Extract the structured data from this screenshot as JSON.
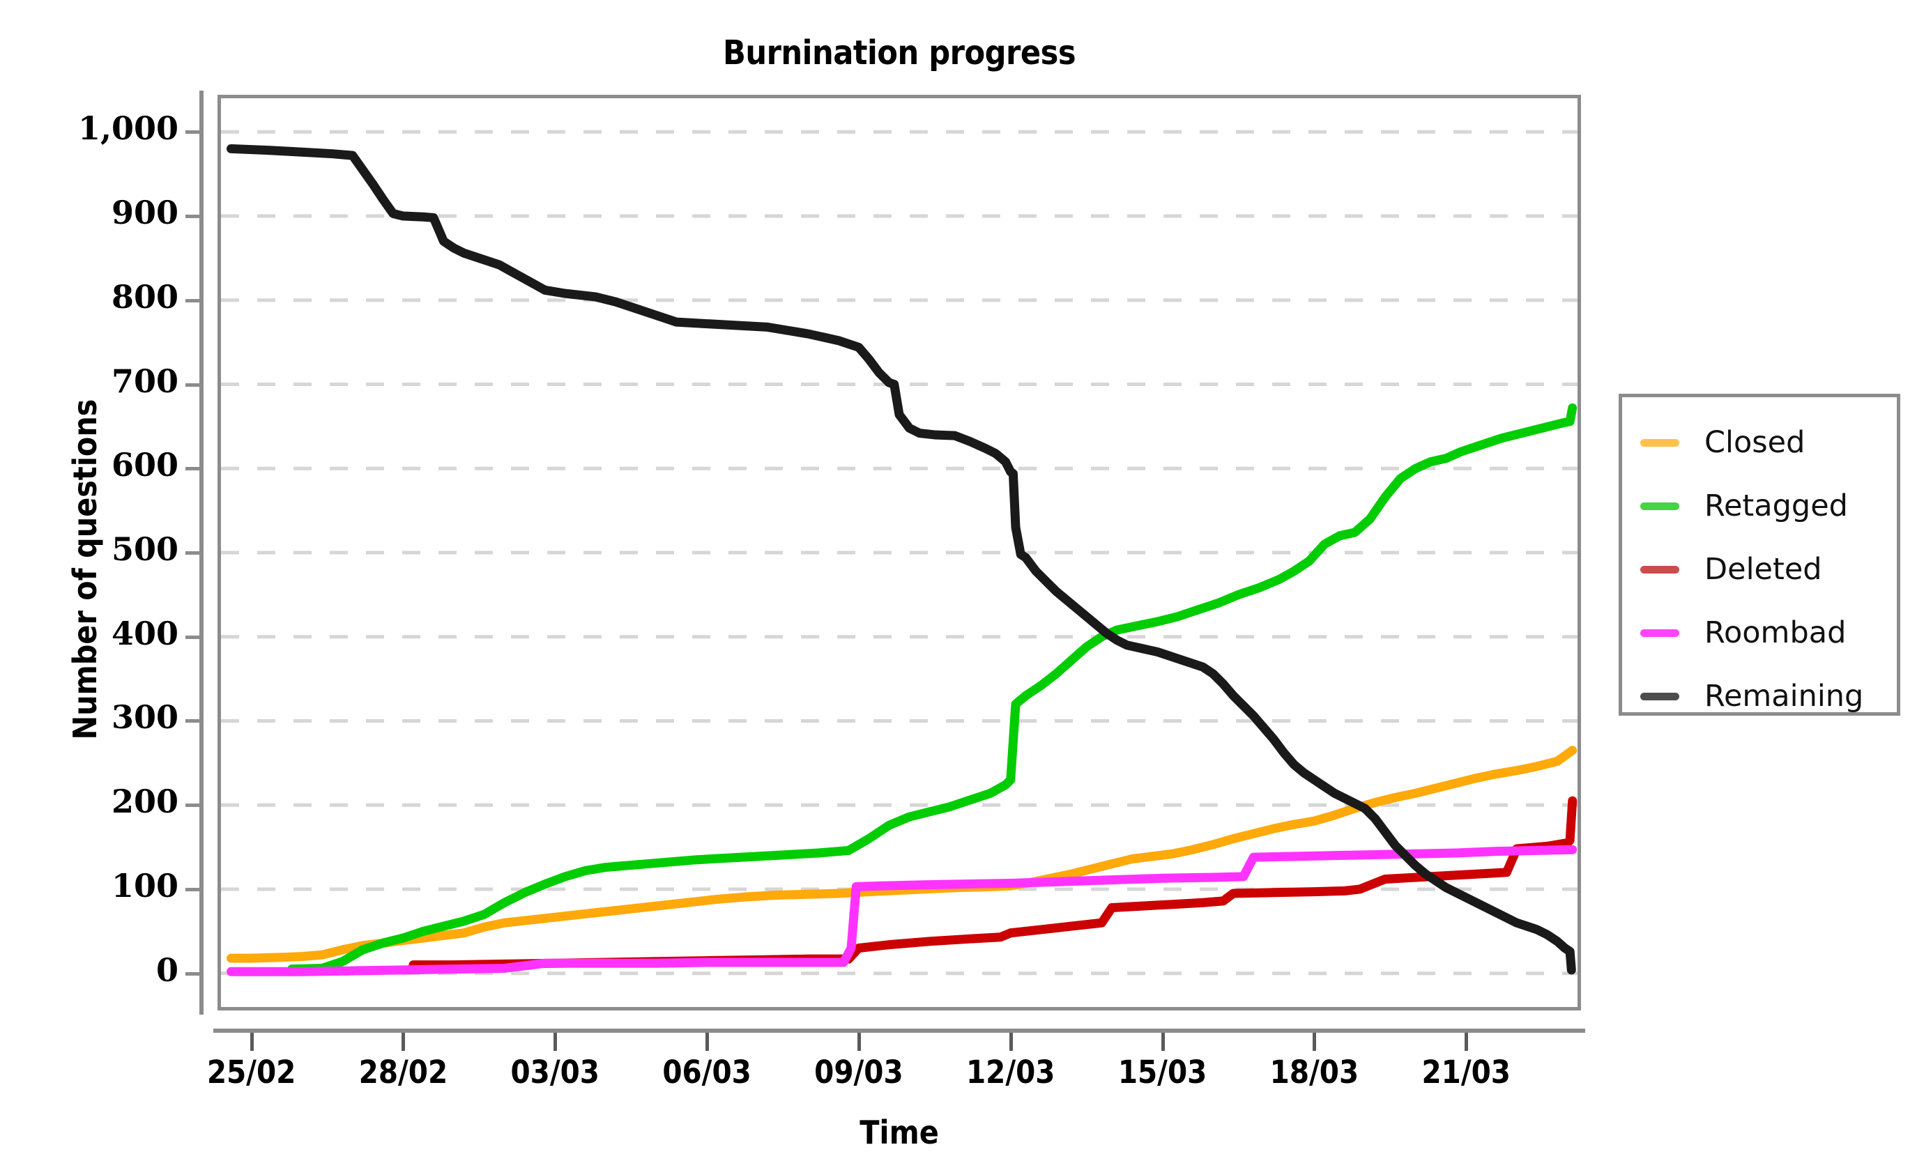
{
  "chart_data": {
    "type": "line",
    "title": "Burnination progress",
    "xlabel": "Time",
    "ylabel": "Number of questions",
    "grid": "horizontal-dashed",
    "legend_position": "right-outside",
    "ylim": [
      -40,
      1040
    ],
    "yticks": [
      0,
      100,
      200,
      300,
      400,
      500,
      600,
      700,
      800,
      900,
      1000
    ],
    "ytick_labels": [
      "0",
      "100",
      "200",
      "300",
      "400",
      "500",
      "600",
      "700",
      "800",
      "900",
      "1,000"
    ],
    "xtick_labels": [
      "25/02",
      "28/02",
      "03/03",
      "06/03",
      "09/03",
      "12/03",
      "15/03",
      "18/03",
      "21/03"
    ],
    "xlim_days": [
      24.4,
      51.2
    ],
    "xtick_days": [
      25,
      28,
      31,
      34,
      37,
      40,
      43,
      46,
      49
    ],
    "series": [
      {
        "name": "Closed",
        "color": "#FFA90A",
        "legend_color": "#FFC04D",
        "points": [
          [
            24.6,
            18
          ],
          [
            25.0,
            18
          ],
          [
            25.6,
            19
          ],
          [
            26.0,
            20
          ],
          [
            26.4,
            22
          ],
          [
            26.8,
            28
          ],
          [
            27.2,
            33
          ],
          [
            27.6,
            36
          ],
          [
            28.0,
            39
          ],
          [
            28.4,
            42
          ],
          [
            28.8,
            45
          ],
          [
            29.2,
            48
          ],
          [
            29.6,
            55
          ],
          [
            30.0,
            60
          ],
          [
            30.6,
            64
          ],
          [
            31.2,
            68
          ],
          [
            31.8,
            72
          ],
          [
            32.4,
            76
          ],
          [
            33.0,
            80
          ],
          [
            33.6,
            84
          ],
          [
            34.2,
            88
          ],
          [
            34.8,
            91
          ],
          [
            35.4,
            93
          ],
          [
            36.0,
            94
          ],
          [
            36.6,
            95
          ],
          [
            37.2,
            97
          ],
          [
            37.9,
            99
          ],
          [
            38.6,
            101
          ],
          [
            39.0,
            102
          ],
          [
            39.6,
            103
          ],
          [
            40.0,
            104
          ],
          [
            40.4,
            108
          ],
          [
            40.8,
            113
          ],
          [
            41.2,
            118
          ],
          [
            41.6,
            124
          ],
          [
            42.0,
            130
          ],
          [
            42.4,
            136
          ],
          [
            42.8,
            139
          ],
          [
            43.2,
            142
          ],
          [
            43.6,
            147
          ],
          [
            44.0,
            153
          ],
          [
            44.4,
            160
          ],
          [
            44.8,
            166
          ],
          [
            45.2,
            172
          ],
          [
            45.6,
            177
          ],
          [
            46.0,
            181
          ],
          [
            46.4,
            188
          ],
          [
            46.8,
            196
          ],
          [
            47.2,
            203
          ],
          [
            47.6,
            209
          ],
          [
            48.0,
            214
          ],
          [
            48.4,
            220
          ],
          [
            48.8,
            226
          ],
          [
            49.2,
            232
          ],
          [
            49.6,
            237
          ],
          [
            50.0,
            241
          ],
          [
            50.4,
            246
          ],
          [
            50.8,
            252
          ],
          [
            51.1,
            265
          ]
        ]
      },
      {
        "name": "Retagged",
        "color": "#00CC00",
        "legend_color": "#44D444",
        "points": [
          [
            25.8,
            5
          ],
          [
            26.4,
            6
          ],
          [
            26.8,
            14
          ],
          [
            27.2,
            28
          ],
          [
            27.6,
            36
          ],
          [
            28.0,
            42
          ],
          [
            28.4,
            50
          ],
          [
            28.8,
            56
          ],
          [
            29.2,
            62
          ],
          [
            29.6,
            70
          ],
          [
            30.0,
            84
          ],
          [
            30.4,
            96
          ],
          [
            30.8,
            106
          ],
          [
            31.2,
            115
          ],
          [
            31.6,
            122
          ],
          [
            32.0,
            126
          ],
          [
            32.6,
            129
          ],
          [
            33.2,
            132
          ],
          [
            33.8,
            135
          ],
          [
            34.4,
            137
          ],
          [
            35.0,
            139
          ],
          [
            35.6,
            141
          ],
          [
            36.2,
            143
          ],
          [
            36.8,
            146
          ],
          [
            37.2,
            160
          ],
          [
            37.6,
            176
          ],
          [
            38.0,
            186
          ],
          [
            38.4,
            192
          ],
          [
            38.8,
            198
          ],
          [
            39.2,
            206
          ],
          [
            39.6,
            214
          ],
          [
            39.9,
            224
          ],
          [
            40.0,
            230
          ],
          [
            40.1,
            320
          ],
          [
            40.3,
            330
          ],
          [
            40.6,
            342
          ],
          [
            40.9,
            356
          ],
          [
            41.2,
            372
          ],
          [
            41.5,
            388
          ],
          [
            41.8,
            400
          ],
          [
            42.1,
            408
          ],
          [
            42.5,
            413
          ],
          [
            42.9,
            418
          ],
          [
            43.3,
            424
          ],
          [
            43.7,
            432
          ],
          [
            44.1,
            440
          ],
          [
            44.5,
            450
          ],
          [
            44.9,
            458
          ],
          [
            45.3,
            468
          ],
          [
            45.6,
            478
          ],
          [
            45.9,
            490
          ],
          [
            46.2,
            510
          ],
          [
            46.5,
            520
          ],
          [
            46.8,
            524
          ],
          [
            47.1,
            540
          ],
          [
            47.4,
            566
          ],
          [
            47.7,
            588
          ],
          [
            48.0,
            600
          ],
          [
            48.3,
            608
          ],
          [
            48.6,
            612
          ],
          [
            48.9,
            620
          ],
          [
            49.3,
            628
          ],
          [
            49.7,
            636
          ],
          [
            50.1,
            642
          ],
          [
            50.5,
            648
          ],
          [
            50.9,
            654
          ],
          [
            51.05,
            656
          ],
          [
            51.1,
            672
          ]
        ]
      },
      {
        "name": "Deleted",
        "color": "#CC0000",
        "legend_color": "#CC4C4C",
        "points": [
          [
            28.2,
            10
          ],
          [
            29.0,
            10
          ],
          [
            30.0,
            11
          ],
          [
            31.0,
            12
          ],
          [
            32.0,
            13
          ],
          [
            33.0,
            14
          ],
          [
            34.0,
            15
          ],
          [
            35.0,
            16
          ],
          [
            36.0,
            17
          ],
          [
            36.8,
            17
          ],
          [
            37.0,
            30
          ],
          [
            37.6,
            34
          ],
          [
            38.4,
            38
          ],
          [
            39.2,
            41
          ],
          [
            39.8,
            43
          ],
          [
            40.0,
            48
          ],
          [
            40.6,
            52
          ],
          [
            41.2,
            56
          ],
          [
            41.8,
            60
          ],
          [
            42.0,
            78
          ],
          [
            42.6,
            80
          ],
          [
            43.2,
            82
          ],
          [
            43.8,
            84
          ],
          [
            44.2,
            86
          ],
          [
            44.4,
            95
          ],
          [
            45.2,
            96
          ],
          [
            46.0,
            97
          ],
          [
            46.6,
            98
          ],
          [
            46.9,
            100
          ],
          [
            47.4,
            112
          ],
          [
            48.0,
            114
          ],
          [
            48.6,
            116
          ],
          [
            49.2,
            118
          ],
          [
            49.8,
            120
          ],
          [
            50.0,
            148
          ],
          [
            50.6,
            151
          ],
          [
            51.0,
            155
          ],
          [
            51.05,
            158
          ],
          [
            51.1,
            205
          ]
        ]
      },
      {
        "name": "Roombad",
        "color": "#FF33FF",
        "legend_color": "#FF44FF",
        "points": [
          [
            24.6,
            2
          ],
          [
            26.0,
            2
          ],
          [
            27.0,
            3
          ],
          [
            28.0,
            4
          ],
          [
            29.0,
            5
          ],
          [
            30.0,
            6
          ],
          [
            30.8,
            12
          ],
          [
            32.0,
            12
          ],
          [
            33.0,
            12
          ],
          [
            34.0,
            13
          ],
          [
            35.0,
            13
          ],
          [
            36.0,
            13
          ],
          [
            36.7,
            13
          ],
          [
            36.85,
            30
          ],
          [
            36.95,
            103
          ],
          [
            37.5,
            104
          ],
          [
            38.2,
            105
          ],
          [
            39.0,
            106
          ],
          [
            40.0,
            107
          ],
          [
            41.0,
            109
          ],
          [
            42.0,
            111
          ],
          [
            43.0,
            113
          ],
          [
            44.0,
            114
          ],
          [
            44.6,
            115
          ],
          [
            44.8,
            138
          ],
          [
            45.6,
            139
          ],
          [
            46.4,
            140
          ],
          [
            47.2,
            141
          ],
          [
            48.0,
            142
          ],
          [
            48.8,
            143
          ],
          [
            49.6,
            145
          ],
          [
            50.4,
            146
          ],
          [
            51.1,
            147
          ]
        ]
      },
      {
        "name": "Remaining",
        "color": "#1A1A1A",
        "legend_color": "#4D4D4D",
        "points": [
          [
            24.6,
            980
          ],
          [
            25.4,
            978
          ],
          [
            26.0,
            976
          ],
          [
            26.6,
            974
          ],
          [
            27.0,
            972
          ],
          [
            27.2,
            955
          ],
          [
            27.4,
            938
          ],
          [
            27.6,
            920
          ],
          [
            27.8,
            903
          ],
          [
            28.0,
            900
          ],
          [
            28.4,
            899
          ],
          [
            28.6,
            898
          ],
          [
            28.8,
            870
          ],
          [
            29.0,
            862
          ],
          [
            29.2,
            856
          ],
          [
            29.6,
            848
          ],
          [
            29.9,
            842
          ],
          [
            30.2,
            832
          ],
          [
            30.5,
            822
          ],
          [
            30.8,
            812
          ],
          [
            31.2,
            808
          ],
          [
            31.8,
            804
          ],
          [
            32.2,
            798
          ],
          [
            32.6,
            790
          ],
          [
            33.0,
            782
          ],
          [
            33.4,
            774
          ],
          [
            34.0,
            772
          ],
          [
            34.6,
            770
          ],
          [
            35.2,
            768
          ],
          [
            35.6,
            764
          ],
          [
            36.0,
            760
          ],
          [
            36.3,
            756
          ],
          [
            36.6,
            752
          ],
          [
            36.8,
            748
          ],
          [
            37.0,
            744
          ],
          [
            37.2,
            730
          ],
          [
            37.4,
            714
          ],
          [
            37.6,
            702
          ],
          [
            37.7,
            700
          ],
          [
            37.8,
            664
          ],
          [
            38.0,
            648
          ],
          [
            38.2,
            642
          ],
          [
            38.5,
            640
          ],
          [
            38.9,
            639
          ],
          [
            39.2,
            632
          ],
          [
            39.5,
            624
          ],
          [
            39.7,
            618
          ],
          [
            39.9,
            608
          ],
          [
            40.0,
            596
          ],
          [
            40.05,
            594
          ],
          [
            40.1,
            530
          ],
          [
            40.2,
            498
          ],
          [
            40.3,
            494
          ],
          [
            40.5,
            478
          ],
          [
            40.7,
            466
          ],
          [
            40.9,
            454
          ],
          [
            41.1,
            444
          ],
          [
            41.3,
            434
          ],
          [
            41.5,
            424
          ],
          [
            41.7,
            414
          ],
          [
            41.9,
            404
          ],
          [
            42.1,
            396
          ],
          [
            42.3,
            390
          ],
          [
            42.6,
            386
          ],
          [
            42.9,
            382
          ],
          [
            43.2,
            376
          ],
          [
            43.5,
            370
          ],
          [
            43.8,
            364
          ],
          [
            44.0,
            356
          ],
          [
            44.2,
            344
          ],
          [
            44.4,
            330
          ],
          [
            44.6,
            318
          ],
          [
            44.8,
            306
          ],
          [
            45.0,
            292
          ],
          [
            45.2,
            278
          ],
          [
            45.4,
            262
          ],
          [
            45.6,
            248
          ],
          [
            45.8,
            238
          ],
          [
            46.0,
            230
          ],
          [
            46.2,
            222
          ],
          [
            46.4,
            214
          ],
          [
            46.6,
            208
          ],
          [
            46.8,
            202
          ],
          [
            47.0,
            196
          ],
          [
            47.2,
            184
          ],
          [
            47.4,
            168
          ],
          [
            47.6,
            152
          ],
          [
            47.8,
            140
          ],
          [
            48.0,
            128
          ],
          [
            48.2,
            118
          ],
          [
            48.4,
            110
          ],
          [
            48.6,
            102
          ],
          [
            48.8,
            96
          ],
          [
            49.0,
            90
          ],
          [
            49.2,
            84
          ],
          [
            49.4,
            78
          ],
          [
            49.6,
            72
          ],
          [
            49.8,
            66
          ],
          [
            50.0,
            60
          ],
          [
            50.2,
            56
          ],
          [
            50.4,
            52
          ],
          [
            50.6,
            46
          ],
          [
            50.8,
            38
          ],
          [
            50.95,
            30
          ],
          [
            51.05,
            26
          ],
          [
            51.08,
            4
          ]
        ]
      }
    ]
  },
  "legend": {
    "items": [
      {
        "label": "Closed"
      },
      {
        "label": "Retagged"
      },
      {
        "label": "Deleted"
      },
      {
        "label": "Roombad"
      },
      {
        "label": "Remaining"
      }
    ]
  }
}
